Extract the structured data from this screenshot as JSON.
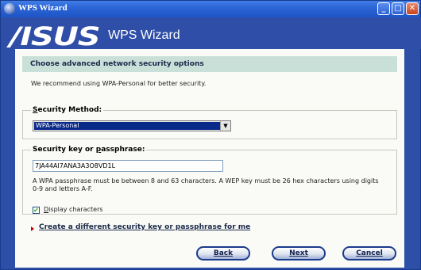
{
  "window": {
    "title": "WPS Wizard"
  },
  "banner": {
    "logo_text": "/ISUS",
    "wizard_title": "WPS Wizard"
  },
  "section": {
    "header": "Choose advanced network security options"
  },
  "recommendation": "We recommend using WPA-Personal for better security.",
  "security_method": {
    "label_mnemonic": "S",
    "label_rest": "ecurity Method:",
    "selected": "WPA-Personal"
  },
  "security_key": {
    "label_before": "Security key or ",
    "label_mnemonic": "p",
    "label_after": "assphrase:",
    "value": "7JA44AI7ANA3A3O8VD1L",
    "help": "A WPA passphrase must be between 8 and 63 characters. A WEP key must be 26 hex characters using digits 0-9 and letters A-F.",
    "display_characters_checked": true,
    "display_characters_mnemonic": "D",
    "display_characters_rest": "isplay characters"
  },
  "link": "Create a different security key or passphrase for me",
  "buttons": {
    "back": "Back",
    "next": "Next",
    "cancel": "Cancel"
  },
  "colors": {
    "banner": "#2f4ea7",
    "header": "#c9e0d8",
    "selection": "#0a2a8a"
  }
}
